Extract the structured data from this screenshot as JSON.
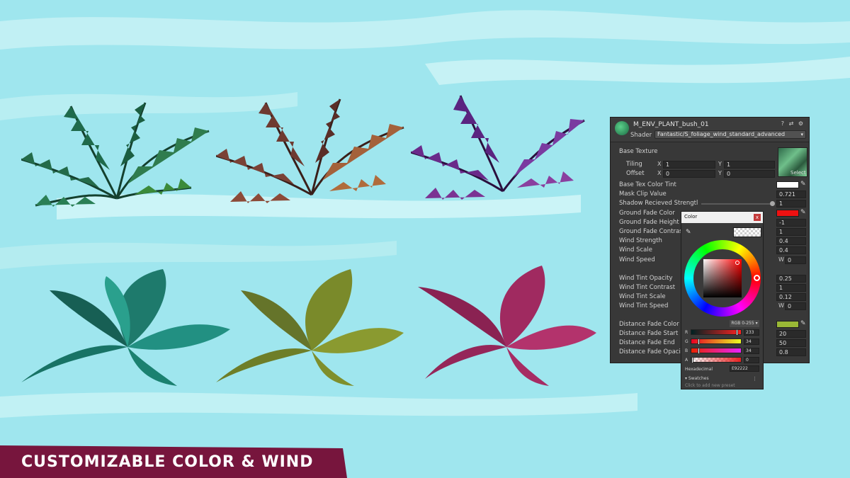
{
  "banner": {
    "text": "CUSTOMIZABLE COLOR & WIND",
    "color": "#77153d"
  },
  "plants": [
    {
      "kind": "fern",
      "color": "#1f6a4b"
    },
    {
      "kind": "fern",
      "color": "#8a4a3c"
    },
    {
      "kind": "fern",
      "color": "#6a2a8a"
    },
    {
      "kind": "monstera",
      "color": "#1e8a78"
    },
    {
      "kind": "monstera",
      "color": "#7a8a2a"
    },
    {
      "kind": "monstera",
      "color": "#a02a60"
    }
  ],
  "inspector": {
    "material_name": "M_ENV_PLANT_bush_01",
    "header_icons": "? ⇄ ⚙",
    "shader_label": "Shader",
    "shader_value": "Fantastic/S_foliage_wind_standard_advanced",
    "base_texture_label": "Base Texture",
    "tiling_label": "Tiling",
    "offset_label": "Offset",
    "tiling": {
      "x_label": "X",
      "x": "1",
      "y_label": "Y",
      "y": "1"
    },
    "offset": {
      "x_label": "X",
      "x": "0",
      "y_label": "Y",
      "y": "0"
    },
    "texture_select": "Select",
    "props": {
      "base_tex_color_tint": "Base Tex Color Tint",
      "mask_clip_value": "Mask Clip Value",
      "mask_clip_value_val": "0.721",
      "shadow_recieved_strength": "Shadow Recieved Strengtl",
      "shadow_recieved_strength_val": "1",
      "ground_fade_color": "Ground Fade Color",
      "ground_fade_height": "Ground Fade Height",
      "ground_fade_height_val": "-1",
      "ground_fade_contrast": "Ground Fade Contrast",
      "ground_fade_contrast_val": "1",
      "wind_strength": "Wind Strength",
      "wind_strength_val": "0.4",
      "wind_scale": "Wind Scale",
      "wind_scale_val": "0.4",
      "wind_speed": "Wind Speed",
      "wind_speed_w_label": "W",
      "wind_speed_w": "0",
      "wind_tint_opacity": "Wind Tint Opacity",
      "wind_tint_opacity_val": "0.25",
      "wind_tint_contrast": "Wind Tint Contrast",
      "wind_tint_contrast_val": "1",
      "wind_tint_scale": "Wind Tint Scale",
      "wind_tint_scale_val": "0.12",
      "wind_tint_speed": "Wind Tint Speed",
      "wind_tint_speed_w_label": "W",
      "wind_tint_speed_w": "0",
      "distance_fade_color": "Distance Fade Color",
      "distance_fade_start": "Distance Fade Start",
      "distance_fade_start_val": "20",
      "distance_fade_end": "Distance Fade End",
      "distance_fade_end_val": "50",
      "distance_fade_opacity": "Distance Fade Opacity",
      "distance_fade_opacity_val": "0.8"
    },
    "colors": {
      "base_tex_tint": "#ffffff",
      "ground_fade": "#ee1111",
      "distance_fade": "#9ab836"
    },
    "shadow_slider_fraction": 1.0
  },
  "color_picker": {
    "title": "Color",
    "close": "x",
    "mode": "RGB 0-255 ▾",
    "channels": [
      {
        "label": "R",
        "value": "233"
      },
      {
        "label": "G",
        "value": "34"
      },
      {
        "label": "B",
        "value": "34"
      },
      {
        "label": "A",
        "value": "0"
      }
    ],
    "hex_label": "Hexadecimal",
    "hex_value": "E92222",
    "swatches_label": "▾ Swatches",
    "swatches_menu": "⋮",
    "swatches_add": "Click to add new preset",
    "current_color": "#e92222"
  }
}
